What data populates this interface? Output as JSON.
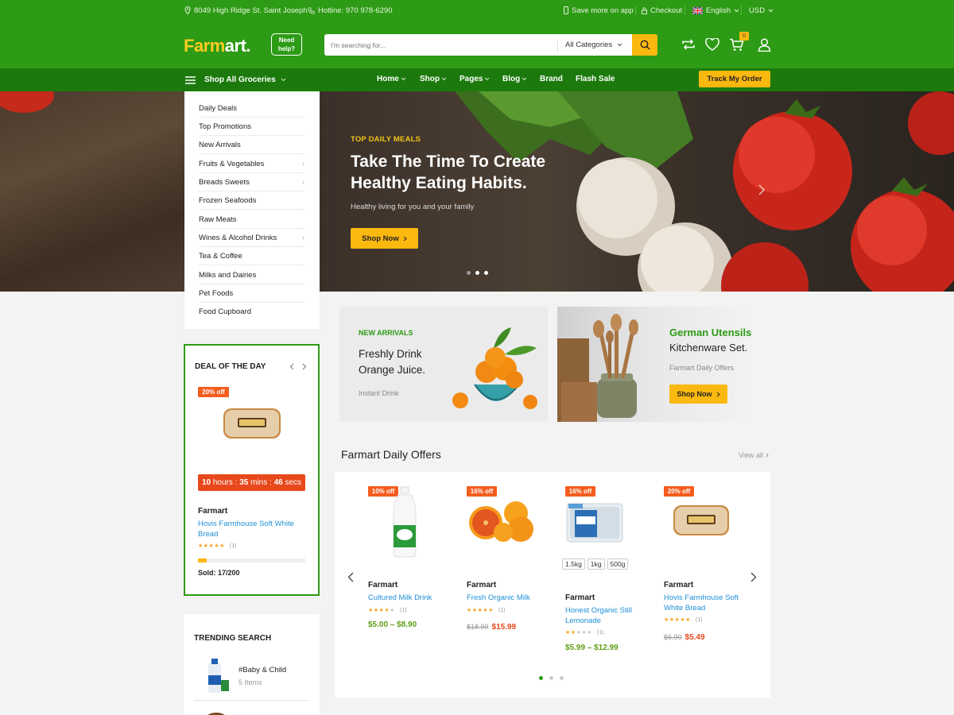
{
  "topbar": {
    "address": "8049 High Ridge St. Saint Joseph",
    "hotline": "Hotline: 970 978-6290",
    "save_app": "Save more on app",
    "checkout": "Checkout",
    "language": "English",
    "currency": "USD"
  },
  "header": {
    "logo_main": "Farm",
    "logo_accent": "art.",
    "need_help": "Need help?",
    "search_placeholder": "I'm searching for...",
    "category": "All Categories",
    "cart_count": "0"
  },
  "nav": {
    "shop_all": "Shop All Groceries",
    "items": [
      "Home",
      "Shop",
      "Pages",
      "Blog",
      "Brand",
      "Flash Sale"
    ],
    "track": "Track My Order"
  },
  "menu": {
    "items": [
      "Daily Deals",
      "Top Promotions",
      "New Arrivals",
      "Fruits & Vegetables",
      "Breads Sweets",
      "Frozen Seafoods",
      "Raw Meats",
      "Wines & Alcohol Drinks",
      "Tea & Coffee",
      "Milks and Dairies",
      "Pet Foods",
      "Food Cupboard"
    ]
  },
  "hero": {
    "subtitle": "TOP DAILY MEALS",
    "title": "Take The Time To Create Healthy Eating Habits.",
    "desc": "Healthy living for you and your family",
    "button": "Shop Now"
  },
  "deal": {
    "title": "DEAL OF THE DAY",
    "badge": "20% off",
    "hours": "10",
    "hours_l": "hours :",
    "mins": "35",
    "mins_l": "mins :",
    "secs": "46",
    "secs_l": "secs",
    "brand": "Farmart",
    "name": "Hovis Farmhouse Soft White Bread",
    "reviews": "(1)",
    "sold": "Sold: 17/200",
    "sold_fraction": 0.085
  },
  "trending": {
    "title": "TRENDING SEARCH",
    "items": [
      {
        "name": "#Baby & Child",
        "count": "5 Items"
      }
    ]
  },
  "banners": {
    "b1": {
      "tag": "NEW ARRIVALS",
      "title": "Freshly Drink Orange Juice.",
      "sub": "Instant Drink"
    },
    "b2": {
      "title_accent": "German Utensils",
      "title": "Kitchenware Set.",
      "sub": "Farmart Daily Offers",
      "button": "Shop Now"
    }
  },
  "offers": {
    "title": "Farmart Daily Offers",
    "view_all": "View all",
    "products": [
      {
        "badge": "10% off",
        "brand": "Farmart",
        "name": "Cultured Milk Drink",
        "reviews": "(1)",
        "price": "$5.00 – $8.90"
      },
      {
        "badge": "16% off",
        "brand": "Farmart",
        "name": "Fresh Organic Milk",
        "reviews": "(1)",
        "old": "$18.99",
        "price": "$15.99"
      },
      {
        "badge": "16% off",
        "variants": [
          "1.5kg",
          "1kg",
          "500g"
        ],
        "brand": "Farmart",
        "name": "Honest Organic Still Lemonade",
        "reviews": "(1)",
        "price": "$5.99 – $12.99"
      },
      {
        "badge": "20% off",
        "brand": "Farmart",
        "name": "Hovis Farmhouse Soft White Bread",
        "reviews": "(1)",
        "old": "$6.90",
        "price": "$5.49"
      }
    ]
  },
  "colors": {
    "green": "#2d9b15",
    "dark_green": "#1c7a0d",
    "yellow": "#fbb80f",
    "orange": "#f55d1e",
    "link": "#1e8fd6"
  }
}
